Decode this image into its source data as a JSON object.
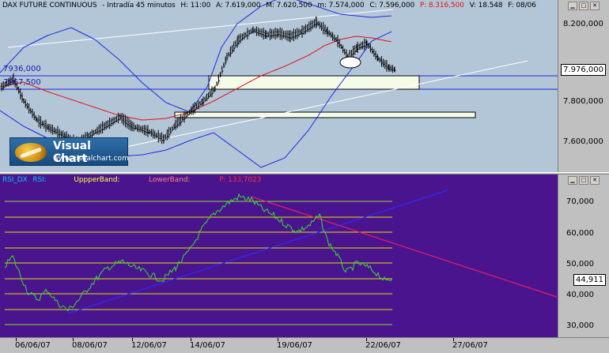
{
  "colors": {
    "price_bg": "#b3c6d8",
    "rsi_bg": "#4b148f",
    "bollinger": "#1a2ae0",
    "ma": "#e01010",
    "trend_white": "#ffffff",
    "rsi_line": "#33dd33",
    "rsi_trend_blue": "#2a2aff",
    "rsi_trend_red": "#e02060",
    "rsi_levels": "#e0e000",
    "rsi_level_green": "#7fdf3a",
    "support_lines": "#1a2ae0",
    "gap_box_fill": "#f4fbe8"
  },
  "header": {
    "title": "DAX FUTURE CONTINUOUS",
    "timeframe": "- Intradía 45 minutos",
    "hour": "H: 11:00",
    "max": "A: 7.619,000",
    "mid": "M: 7.620,500",
    "min": "m: 7.574,000",
    "close": "C: 7.596,000",
    "p": "P: 8.316,500",
    "vol": "V: 18.548",
    "date": "F: 08/06"
  },
  "rsi_header": {
    "name": "RSI_DX",
    "rsi": "RSI:",
    "upper": "UppperBand:",
    "lower": "LowerBand:",
    "p": "P: 133,7023"
  },
  "price_axis": {
    "ticks": [
      "8.200,000",
      "7.800,000",
      "7.600,000"
    ],
    "current": "7.976,000"
  },
  "rsi_axis": {
    "ticks": [
      "70,000",
      "60,000",
      "50,000",
      "40,000",
      "30,000"
    ],
    "current": "44,911"
  },
  "levels": {
    "upper": "7936,000",
    "lower": "7867,500"
  },
  "time_axis": {
    "labels": [
      "06/06/07",
      "08/06/07",
      "12/06/07",
      "14/06/07",
      "19/06/07",
      "22/06/07",
      "27/06/07"
    ]
  },
  "logo": {
    "name": "Visual Chart",
    "url": "www.visualchart.com"
  }
}
